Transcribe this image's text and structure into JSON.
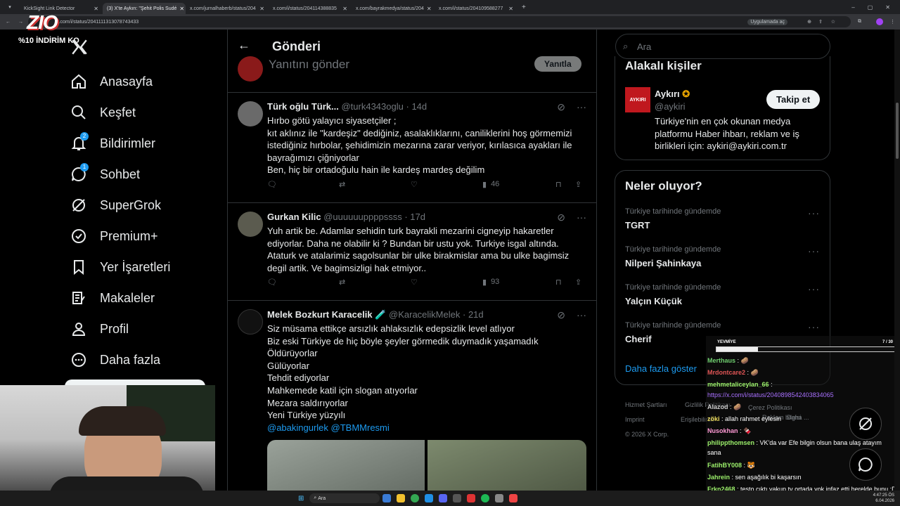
{
  "browser": {
    "tabs": [
      {
        "label": "KickSight Link Detector",
        "active": false
      },
      {
        "label": "(3) X'te Aykırı: \"Şehit Polis Sudé",
        "active": true
      },
      {
        "label": "x.com/jurnalhaberb/status/204",
        "active": false
      },
      {
        "label": "x.com/i/status/204114388835",
        "active": false
      },
      {
        "label": "x.com/bayrakmedya/status/204",
        "active": false
      },
      {
        "label": "x.com/i/status/204109588277",
        "active": false
      }
    ],
    "url": "x.com/i/status/2041111313078743433",
    "open_in_app": "Uygulamada aç"
  },
  "overlay": {
    "logo": "ZIO",
    "promo": "%10 İNDİRİM KO"
  },
  "sidebar": {
    "logo": "X",
    "items": [
      {
        "label": "Anasayfa",
        "icon": "home-icon"
      },
      {
        "label": "Keşfet",
        "icon": "search-icon"
      },
      {
        "label": "Bildirimler",
        "icon": "bell-icon",
        "badge": "2"
      },
      {
        "label": "Sohbet",
        "icon": "chat-icon",
        "badge": "1"
      },
      {
        "label": "SuperGrok",
        "icon": "grok-icon"
      },
      {
        "label": "Premium+",
        "icon": "verified-icon"
      },
      {
        "label": "Yer İşaretleri",
        "icon": "bookmark-icon"
      },
      {
        "label": "Makaleler",
        "icon": "article-icon"
      },
      {
        "label": "Profil",
        "icon": "person-icon"
      },
      {
        "label": "Daha fazla",
        "icon": "more-icon"
      }
    ]
  },
  "header": {
    "title": "Gönderi"
  },
  "reply": {
    "placeholder": "Yanıtını gönder",
    "button": "Yanıtla"
  },
  "posts": [
    {
      "name": "Türk oğlu Türk...",
      "handle": "@turk4343oglu",
      "age": "14d",
      "lines": [
        "Hırbo götü yalayıcı siyasetçiler ;",
        "kıt aklınız ile \"kardeşiz\" dediğiniz, asalaklıklarını, caniliklerini hoş görmemizi",
        "istediğiniz hırbolar, şehidimizin mezarına zarar veriyor, kırılasıca ayakları ile",
        "bayrağımızı çiğniyorlar",
        "Ben, hiç bir ortadoğulu hain ile kardeş mardeş değilim"
      ],
      "views": "46"
    },
    {
      "name": "Gurkan Kilic",
      "handle": "@uuuuuuppppssss",
      "age": "17d",
      "lines": [
        "Yuh artik be. Adamlar sehidin turk bayrakli mezarini cigneyip hakaretler",
        "ediyorlar. Daha ne olabilir ki ? Bundan bir ustu yok. Turkiye isgal altında.",
        "Ataturk ve atalarimiz sagolsunlar bir ulke birakmislar ama bu ulke bagimsiz",
        "degil artik. Ve bagimsizligi hak etmiyor.."
      ],
      "views": "93"
    },
    {
      "name": "Melek Bozkurt Karacelik",
      "emoji": "🧪",
      "handle": "@KaracelikMelek",
      "age": "21d",
      "lines": [
        "Siz müsama ettikçe arsızlık ahlaksızlık edepsizlik level atlıyor",
        "Biz eski Türkiye de hiç böyle şeyler görmedik duymadık yaşamadık",
        "Öldürüyorlar",
        "Gülüyorlar",
        "Tehdit ediyorlar",
        "Mahkemede katil için slogan atıyorlar",
        "Mezara saldırıyorlar",
        "Yeni Türkiye yüzyılı"
      ],
      "mentions": "@abakingurlek @TBMMresmi"
    }
  ],
  "search": {
    "placeholder": "Ara"
  },
  "related": {
    "title": "Alakalı kişiler",
    "name": "Aykırı",
    "handle": "@aykiri",
    "follow": "Takip et",
    "avatar_text": "AYKIRI",
    "bio": [
      "Türkiye'nin en çok okunan medya",
      "platformu Haber ihbarı, reklam ve iş",
      "birlikleri için: aykiri@aykiri.com.tr"
    ]
  },
  "trends": {
    "title": "Neler oluyor?",
    "items": [
      {
        "category": "Türkiye tarihinde gündemde",
        "title": "TGRT"
      },
      {
        "category": "Türkiye tarihinde gündemde",
        "title": "Nilperi Şahinkaya"
      },
      {
        "category": "Türkiye tarihinde gündemde",
        "title": "Yalçın Küçük"
      },
      {
        "category": "Türkiye tarihinde gündemde",
        "title": "Cherif"
      }
    ],
    "more": "Daha fazla göster"
  },
  "footer": {
    "links": [
      "Hizmet Şartları",
      "Gizlilik Politikası",
      "Çerez Politikası",
      "Imprint",
      "Erişilebilirlik",
      "Reklam bilgisi",
      "Daha ..."
    ],
    "copyright": "© 2026 X Corp."
  },
  "chat": {
    "goal_label": "YEVMİYE",
    "goal_count": "7 / 30",
    "goal_progress": 0.233,
    "messages": [
      {
        "user": "Merthaus",
        "color": "#6fcf6f",
        "text": " : 🥔"
      },
      {
        "user": "Mrdontcare2",
        "color": "#e05555",
        "text": " : 🥔"
      },
      {
        "user": "mehmetaliceylan_66",
        "color": "#9cf06b",
        "text": " :"
      },
      {
        "user": "",
        "color": "#a970ff",
        "text": "https://x.com/i/status/2040898542403834065"
      },
      {
        "user": "Alazod",
        "color": "#cccccc",
        "text": " : 🥔"
      },
      {
        "user": "zöki",
        "color": "#f0e060",
        "text": " : allah rahmet eylesin"
      },
      {
        "user": "Nusokhan",
        "color": "#ff9ad5",
        "text": " : 🍫"
      },
      {
        "user": "philippthomsen",
        "color": "#9cf06b",
        "text": " : VK'da var Efe bilgin olsun bana ulaş atayım sana"
      },
      {
        "user": "FatihBY008",
        "color": "#9cf06b",
        "text": " : 🐯"
      },
      {
        "user": "Jahrein",
        "color": "#9cf06b",
        "text": " : sen aşağılık bi kaşarsın"
      },
      {
        "user": "Frkn2468",
        "color": "#9cf06b",
        "text": " : testo çıktı yakup tv ortada yok infaz etti herelde bunu :D @cavs"
      }
    ]
  },
  "taskbar": {
    "search": "Ara",
    "time": "4:47:25 ÖS",
    "date": "6.04.2026"
  }
}
